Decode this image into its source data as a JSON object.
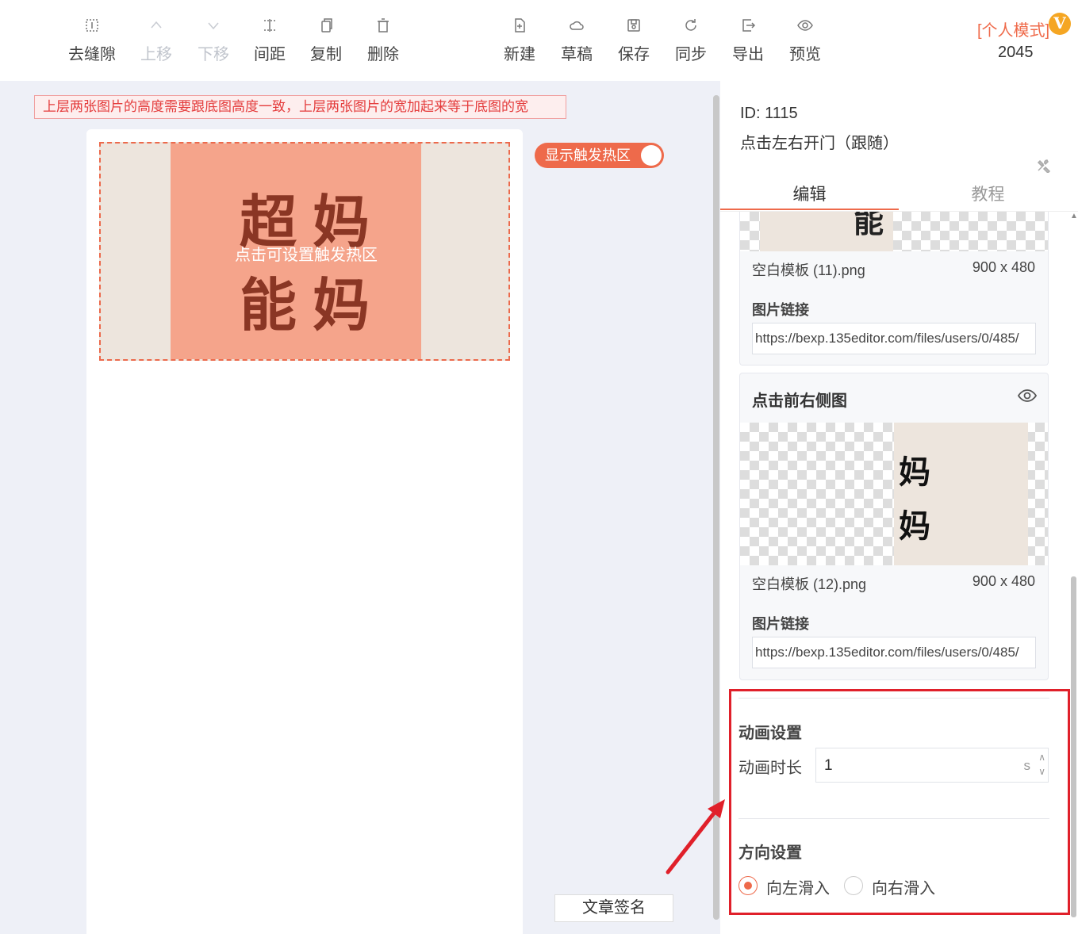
{
  "toolbar": {
    "left": [
      {
        "label": "去缝隙",
        "icon": "gap-icon",
        "disabled": false
      },
      {
        "label": "上移",
        "icon": "chevron-up-icon",
        "disabled": true
      },
      {
        "label": "下移",
        "icon": "chevron-down-icon",
        "disabled": true
      },
      {
        "label": "间距",
        "icon": "spacing-icon",
        "disabled": false
      },
      {
        "label": "复制",
        "icon": "copy-icon",
        "disabled": false
      },
      {
        "label": "删除",
        "icon": "trash-icon",
        "disabled": false
      }
    ],
    "right": [
      {
        "label": "新建",
        "icon": "new-file-icon"
      },
      {
        "label": "草稿",
        "icon": "cloud-icon"
      },
      {
        "label": "保存",
        "icon": "save-icon"
      },
      {
        "label": "同步",
        "icon": "sync-icon"
      },
      {
        "label": "导出",
        "icon": "export-icon"
      },
      {
        "label": "预览",
        "icon": "eye-icon"
      }
    ],
    "mode_label": "[个人模式]",
    "vip_badge": "V",
    "count": "2045"
  },
  "canvas": {
    "notice": "上层两张图片的高度需要跟底图高度一致，上层两张图片的宽加起来等于底图的宽",
    "image_text_top": "超妈",
    "image_text_bottom": "能妈",
    "hotzone_hint": "点击可设置触发热区",
    "toggle_label": "显示触发热区",
    "sign_button": "文章签名"
  },
  "panel": {
    "id_label": "ID: 1115",
    "component_name": "点击左右开门（跟随）",
    "tabs": [
      "编辑",
      "教程"
    ],
    "card1": {
      "partial_char": "能",
      "file_name": "空白模板 (11).png",
      "file_size": "900 x 480",
      "link_label": "图片链接",
      "link_value": "https://bexp.135editor.com/files/users/0/485/"
    },
    "card2": {
      "title": "点击前右侧图",
      "image_chars": [
        "妈",
        "妈"
      ],
      "file_name": "空白模板 (12).png",
      "file_size": "900 x 480",
      "link_label": "图片链接",
      "link_value": "https://bexp.135editor.com/files/users/0/485/"
    },
    "animation": {
      "title": "动画设置",
      "duration_label": "动画时长",
      "duration_value": "1",
      "duration_unit": "s"
    },
    "direction": {
      "title": "方向设置",
      "options": [
        "向左滑入",
        "向右滑入"
      ],
      "selected": 0
    }
  },
  "colors": {
    "accent": "#ee6a4b",
    "highlight": "#e0202a"
  }
}
